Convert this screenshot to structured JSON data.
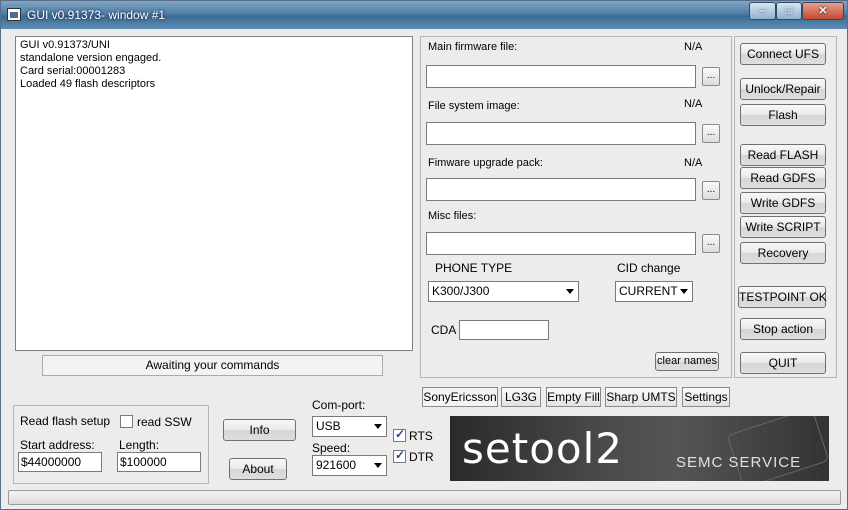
{
  "window": {
    "title": "GUI v0.91373- window #1",
    "controls": {
      "minimize": "–",
      "maximize": "□",
      "close": "✕"
    }
  },
  "log": {
    "lines": [
      "GUI v0.91373/UNI",
      "standalone version engaged.",
      "Card serial:00001283",
      "Loaded 49 flash descriptors"
    ]
  },
  "status": "Awaiting your commands",
  "files": {
    "main_firmware": {
      "label": "Main firmware file:",
      "value": "N/A",
      "input": ""
    },
    "file_system": {
      "label": "File system image:",
      "value": "N/A",
      "input": ""
    },
    "upgrade_pack": {
      "label": "Fimware upgrade pack:",
      "value": "N/A",
      "input": ""
    },
    "misc": {
      "label": "Misc files:",
      "input": ""
    },
    "browse_label": "..."
  },
  "phone": {
    "type_label": "PHONE TYPE",
    "type_value": "K300/J300",
    "cid_label": "CID change",
    "cid_value": "CURRENT",
    "cda_label": "CDA",
    "cda_value": "",
    "clear_names": "clear names"
  },
  "buttons": {
    "connect_ufs": "Connect UFS",
    "unlock_repair": "Unlock/Repair",
    "flash": "Flash",
    "read_flash": "Read FLASH",
    "read_gdfs": "Read GDFS",
    "write_gdfs": "Write GDFS",
    "write_script": "Write SCRIPT",
    "recovery": "Recovery",
    "testpoint_ok": "TESTPOINT OK",
    "stop_action": "Stop action",
    "quit": "QUIT",
    "info": "Info",
    "about": "About"
  },
  "tabs": [
    "SonyEricsson",
    "LG3G",
    "Empty Fill",
    "Sharp UMTS",
    "Settings"
  ],
  "read_flash_setup": {
    "title": "Read flash setup",
    "read_ssw_label": "read SSW",
    "read_ssw_checked": false,
    "start_label": "Start address:",
    "start_value": "$44000000",
    "length_label": "Length:",
    "length_value": "$100000"
  },
  "comport": {
    "label": "Com-port:",
    "value": "USB",
    "speed_label": "Speed:",
    "speed_value": "921600",
    "rts_label": "RTS",
    "rts_checked": true,
    "dtr_label": "DTR",
    "dtr_checked": true
  },
  "banner": {
    "main_text": "setool2",
    "sub_text": "SEMC SERVICE"
  }
}
